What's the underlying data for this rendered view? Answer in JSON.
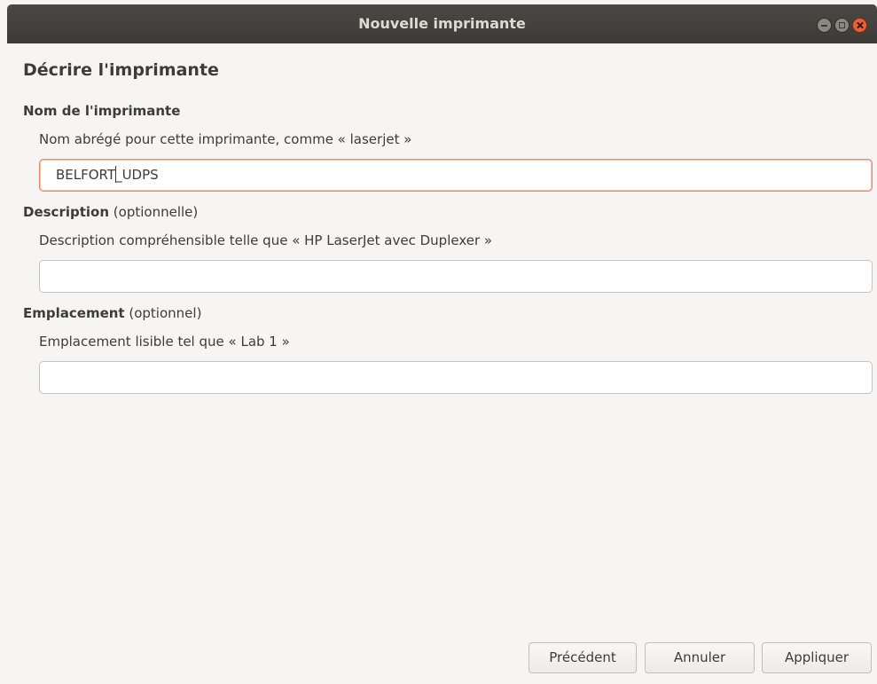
{
  "window": {
    "title": "Nouvelle imprimante",
    "controls": {
      "minimize_icon": "minimize-icon",
      "maximize_icon": "maximize-icon",
      "close_icon": "close-icon"
    }
  },
  "page": {
    "heading": "Décrire l'imprimante",
    "name_section": {
      "label": "Nom de l'imprimante",
      "hint": "Nom abrégé pour cette imprimante, comme « laserjet »",
      "value_before_caret": "BELFORT",
      "value_after_caret": "_UDPS"
    },
    "description_section": {
      "label": "Description",
      "optional": " (optionnelle)",
      "hint": "Description compréhensible telle que « HP LaserJet avec Duplexer »",
      "value": ""
    },
    "location_section": {
      "label": "Emplacement",
      "optional": " (optionnel)",
      "hint": "Emplacement lisible tel que « Lab 1 »",
      "value": ""
    }
  },
  "buttons": {
    "previous": "Précédent",
    "cancel": "Annuler",
    "apply": "Appliquer"
  },
  "colors": {
    "titlebar": "#3c3b37",
    "focus_border": "#e9895e",
    "close_button": "#e8613b"
  }
}
